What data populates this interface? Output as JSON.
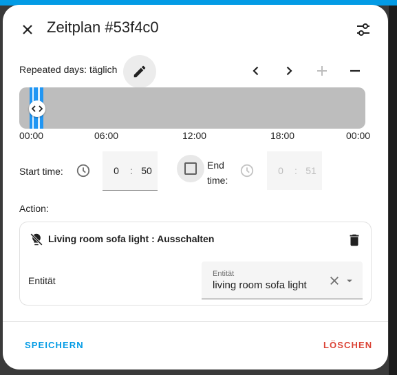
{
  "dialog": {
    "title": "Zeitplan #53f4c0",
    "close_icon": "close-icon",
    "settings_icon": "tune-icon"
  },
  "schedule": {
    "repeated_days_label": "Repeated days: täglich",
    "edit_icon": "pencil-icon",
    "nav_icons": [
      "chevron-left-icon",
      "chevron-right-icon",
      "plus-icon",
      "minus-icon"
    ],
    "timeline_ticks": [
      "00:00",
      "06:00",
      "12:00",
      "18:00",
      "00:00"
    ],
    "timeline_range_hours": [
      0,
      24
    ],
    "slot": {
      "start": "00:50",
      "end": "00:51"
    }
  },
  "times": {
    "start_label": "Start time:",
    "start_hour": "0",
    "start_minute": "50",
    "separator": ":",
    "end_checkbox_checked": false,
    "end_label": "End time:",
    "end_hour": "0",
    "end_minute": "51",
    "clock_icon": "clock-icon"
  },
  "action": {
    "section_label": "Action:",
    "title": "Living room sofa light : Ausschalten",
    "action_icon": "lightbulb-off-icon",
    "delete_icon": "delete-icon",
    "entity_label": "Entität",
    "entity_field_label": "Entität",
    "entity_value": "living room sofa light"
  },
  "footer": {
    "save_label": "SPEICHERN",
    "delete_label": "LÖSCHEN"
  },
  "colors": {
    "accent": "#039be5",
    "danger": "#db4437",
    "slot": "#2196f3",
    "timeline_bg": "#bdbdbd"
  }
}
